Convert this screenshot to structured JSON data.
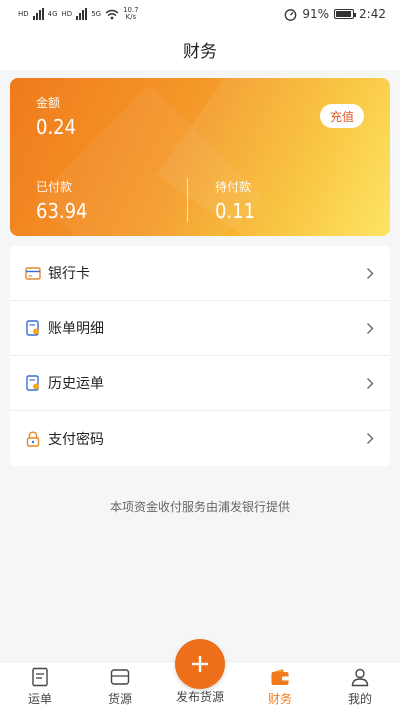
{
  "status_bar": {
    "net_left": "HD",
    "net_4g": "4G",
    "net_right": "HD",
    "net_5g": "5G",
    "speed_value": "10.7",
    "speed_unit": "K/s",
    "battery_percent": "91%",
    "battery_level": 0.91,
    "time": "2:42"
  },
  "header": {
    "title": "财务"
  },
  "balance_card": {
    "amount_label": "金额",
    "amount_value": "0.24",
    "recharge_label": "充值",
    "paid_label": "已付款",
    "paid_value": "63.94",
    "pending_label": "待付款",
    "pending_value": "0.11"
  },
  "menu": {
    "items": [
      {
        "label": "银行卡",
        "icon": "bank-card-icon"
      },
      {
        "label": "账单明细",
        "icon": "bill-detail-icon"
      },
      {
        "label": "历史运单",
        "icon": "history-waybill-icon"
      },
      {
        "label": "支付密码",
        "icon": "lock-icon"
      }
    ]
  },
  "footer_note": "本项资金收付服务由浦发银行提供",
  "bottom_nav": {
    "items": [
      {
        "label": "运单",
        "icon": "waybill-icon"
      },
      {
        "label": "货源",
        "icon": "cargo-icon"
      },
      {
        "label": "发布货源",
        "icon": "plus-icon"
      },
      {
        "label": "财务",
        "icon": "wallet-icon"
      },
      {
        "label": "我的",
        "icon": "profile-icon"
      }
    ],
    "active": "财务"
  },
  "colors": {
    "accent": "#f07a1c",
    "card_gradient_start": "#f07a1c",
    "card_gradient_end": "#fde35a",
    "recharge_text": "#e05a2a"
  }
}
